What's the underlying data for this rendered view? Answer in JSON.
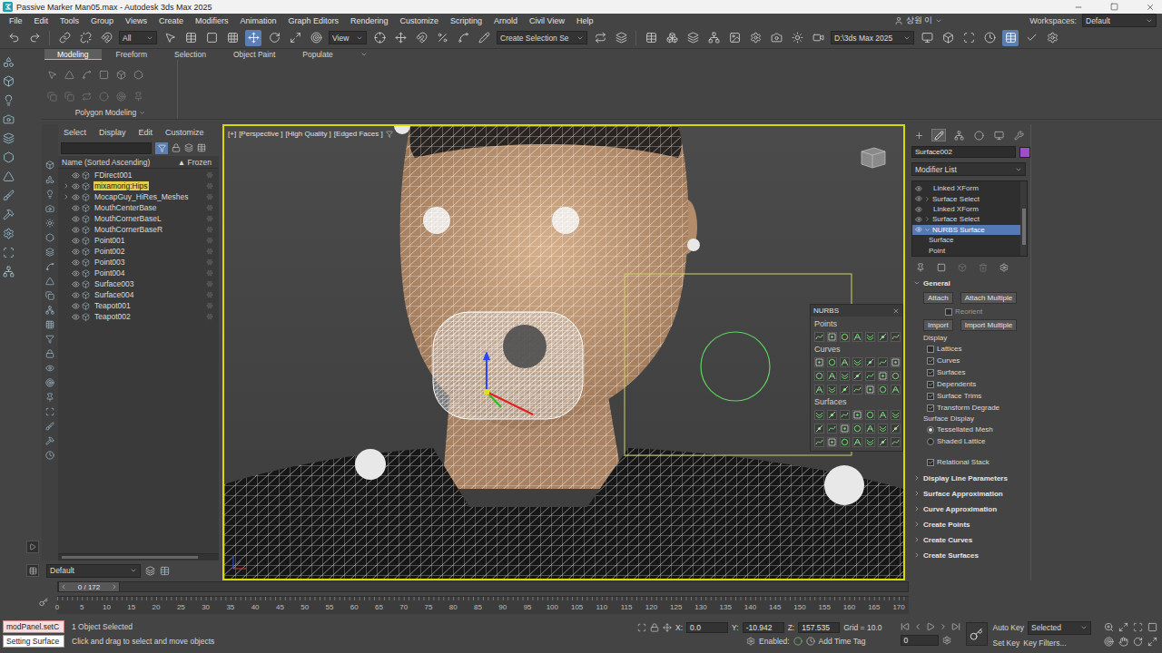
{
  "window": {
    "title": "Passive Marker Man05.max - Autodesk 3ds Max 2025"
  },
  "menu": [
    "File",
    "Edit",
    "Tools",
    "Group",
    "Views",
    "Create",
    "Modifiers",
    "Animation",
    "Graph Editors",
    "Rendering",
    "Customize",
    "Scripting",
    "Arnold",
    "Civil View",
    "Help"
  ],
  "account": {
    "user": "상원 이",
    "workspaces_label": "Workspaces:",
    "workspace": "Default"
  },
  "toolbar": {
    "filter": "All",
    "reference_coord": "View",
    "selection_set": "Create Selection Se",
    "project": "D:\\3ds Max 2025"
  },
  "ribbon": {
    "tabs": [
      {
        "label": "Modeling",
        "selected": true
      },
      {
        "label": "Freeform",
        "selected": false
      },
      {
        "label": "Selection",
        "selected": false
      },
      {
        "label": "Object Paint",
        "selected": false
      },
      {
        "label": "Populate",
        "selected": false
      }
    ],
    "panel": "Polygon Modeling"
  },
  "scene_explorer": {
    "menu": [
      "Select",
      "Display",
      "Edit",
      "Customize"
    ],
    "columns": [
      {
        "label": "Name (Sorted Ascending)"
      },
      {
        "label": "Frozen"
      }
    ],
    "sort_indicator": "▲",
    "rows": [
      {
        "name": "FDirect001",
        "expandable": false,
        "highlighted": false,
        "visible": true
      },
      {
        "name": "mixamorig:Hips",
        "expandable": true,
        "highlighted": true,
        "visible": true
      },
      {
        "name": "MocapGuy_HiRes_Meshes",
        "expandable": true,
        "highlighted": false,
        "visible": true
      },
      {
        "name": "MouthCenterBase",
        "expandable": false,
        "highlighted": false,
        "visible": true
      },
      {
        "name": "MouthCornerBaseL",
        "expandable": false,
        "highlighted": false,
        "visible": true
      },
      {
        "name": "MouthCornerBaseR",
        "expandable": false,
        "highlighted": false,
        "visible": true
      },
      {
        "name": "Point001",
        "expandable": false,
        "highlighted": false,
        "visible": true
      },
      {
        "name": "Point002",
        "expandable": false,
        "highlighted": false,
        "visible": true
      },
      {
        "name": "Point003",
        "expandable": false,
        "highlighted": false,
        "visible": true
      },
      {
        "name": "Point004",
        "expandable": false,
        "highlighted": false,
        "visible": true
      },
      {
        "name": "Surface003",
        "expandable": false,
        "highlighted": false,
        "visible": true
      },
      {
        "name": "Surface004",
        "expandable": false,
        "highlighted": false,
        "visible": true
      },
      {
        "name": "Teapot001",
        "expandable": false,
        "highlighted": false,
        "visible": true
      },
      {
        "name": "Teapot002",
        "expandable": false,
        "highlighted": false,
        "visible": true
      }
    ]
  },
  "layer": "Default",
  "viewport": {
    "labels": [
      "[+]",
      "[Perspective ]",
      "[High Quality ]",
      "[Edged Faces ]"
    ],
    "active": true
  },
  "nurbs_panel": {
    "title": "NURBS",
    "sections": [
      "Points",
      "Curves",
      "Surfaces"
    ]
  },
  "command_panel": {
    "tabs": [
      {
        "selected": false
      },
      {
        "selected": true
      },
      {
        "selected": false
      },
      {
        "selected": false
      },
      {
        "selected": false
      },
      {
        "selected": false
      }
    ],
    "object_name": "Surface002",
    "object_color": "#9b4fc9",
    "modifier_list": "Modifier List",
    "stack": [
      {
        "label": "Linked XForm",
        "kind": "modifier",
        "expandable": false,
        "expanded": false,
        "selected": false
      },
      {
        "label": "Surface Select",
        "kind": "modifier",
        "expandable": true,
        "expanded": false,
        "selected": false
      },
      {
        "label": "Linked XForm",
        "kind": "modifier",
        "expandable": false,
        "expanded": false,
        "selected": false
      },
      {
        "label": "Surface Select",
        "kind": "modifier",
        "expandable": true,
        "expanded": false,
        "selected": false
      },
      {
        "label": "NURBS Surface",
        "kind": "modifier",
        "expandable": true,
        "expanded": true,
        "selected": true
      },
      {
        "label": "Surface",
        "kind": "subobject",
        "expandable": false,
        "expanded": false,
        "selected": false
      },
      {
        "label": "Point",
        "kind": "subobject",
        "expandable": false,
        "expanded": false,
        "selected": false
      }
    ],
    "general": {
      "title": "General",
      "expanded": true,
      "buttons_row1": [
        "Attach",
        "Attach Multiple"
      ],
      "reorient": {
        "label": "Reorient",
        "checked": false,
        "disabled": true
      },
      "buttons_row2": [
        "Import",
        "Import Multiple"
      ],
      "display_label": "Display",
      "display_checks": [
        {
          "label": "Lattices",
          "checked": false
        },
        {
          "label": "Curves",
          "checked": true
        },
        {
          "label": "Surfaces",
          "checked": true
        },
        {
          "label": "Dependents",
          "checked": true
        },
        {
          "label": "Surface Trims",
          "checked": true
        },
        {
          "label": "Transform Degrade",
          "checked": true
        }
      ],
      "surface_display_label": "Surface Display",
      "surface_display": [
        {
          "label": "Tessellated Mesh",
          "selected": true
        },
        {
          "label": "Shaded Lattice",
          "selected": false
        }
      ],
      "relational_stack": {
        "label": "Relational Stack",
        "checked": true
      }
    },
    "rollouts": [
      {
        "label": "Display Line Parameters",
        "expanded": false
      },
      {
        "label": "Surface Approximation",
        "expanded": false
      },
      {
        "label": "Curve Approximation",
        "expanded": false
      },
      {
        "label": "Create Points",
        "expanded": false
      },
      {
        "label": "Create Curves",
        "expanded": false
      },
      {
        "label": "Create Surfaces",
        "expanded": false
      }
    ]
  },
  "timeline": {
    "position": "0 / 172",
    "level": 0,
    "ticks": [
      "0",
      "5",
      "10",
      "15",
      "20",
      "25",
      "30",
      "35",
      "40",
      "45",
      "50",
      "55",
      "60",
      "65",
      "70",
      "75",
      "80",
      "85",
      "90",
      "95",
      "100",
      "105",
      "110",
      "115",
      "120",
      "125",
      "130",
      "135",
      "140",
      "145",
      "150",
      "155",
      "160",
      "165",
      "170"
    ]
  },
  "status": {
    "listener_input": "modPanel.setC",
    "listener_output": "Setting Surface",
    "selection": "1 Object Selected",
    "prompt": "Click and drag to select and move objects",
    "coords": [
      {
        "label": "X:",
        "value": "0.0"
      },
      {
        "label": "Y:",
        "value": "-10.942"
      },
      {
        "label": "Z:",
        "value": "157.535"
      }
    ],
    "grid": "Grid = 10.0",
    "time_tag": {
      "label": "Enabled:",
      "action": "Add Time Tag"
    },
    "frame": "0",
    "auto_key": "Auto Key",
    "key_mode": "Selected",
    "set_key": "Set Key",
    "key_filters": "Key Filters..."
  }
}
